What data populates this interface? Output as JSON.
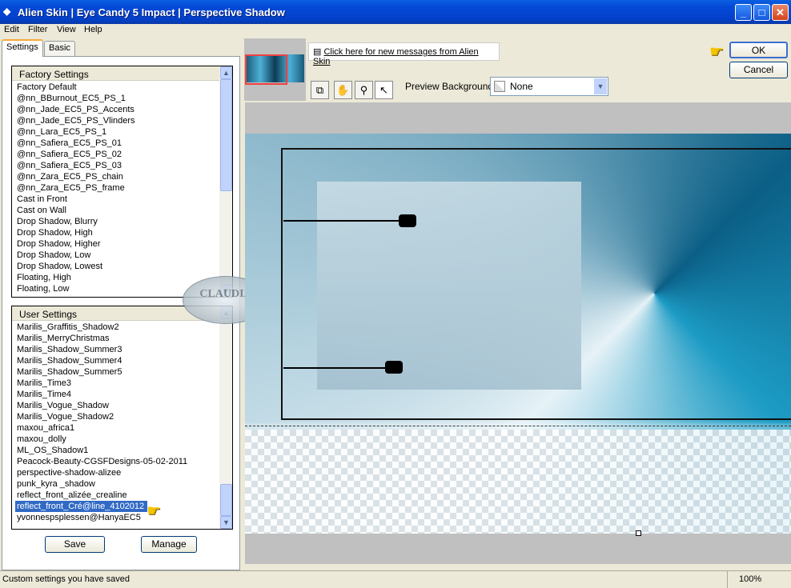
{
  "window": {
    "title": "Alien Skin | Eye Candy 5 Impact | Perspective Shadow"
  },
  "menu": [
    "Edit",
    "Filter",
    "View",
    "Help"
  ],
  "tabs": [
    "Settings",
    "Basic"
  ],
  "factory": {
    "header": "Factory Settings",
    "items": [
      "Factory Default",
      "@nn_BBurnout_EC5_PS_1",
      "@nn_Jade_EC5_PS_Accents",
      "@nn_Jade_EC5_PS_Vlinders",
      "@nn_Lara_EC5_PS_1",
      "@nn_Safiera_EC5_PS_01",
      "@nn_Safiera_EC5_PS_02",
      "@nn_Safiera_EC5_PS_03",
      "@nn_Zara_EC5_PS_chain",
      "@nn_Zara_EC5_PS_frame",
      "Cast in Front",
      "Cast on Wall",
      "Drop Shadow, Blurry",
      "Drop Shadow, High",
      "Drop Shadow, Higher",
      "Drop Shadow, Low",
      "Drop Shadow, Lowest",
      "Floating, High",
      "Floating, Low"
    ]
  },
  "user": {
    "header": "User Settings",
    "items": [
      "Marilis_Graffitis_Shadow2",
      "Marilis_MerryChristmas",
      "Marilis_Shadow_Summer3",
      "Marilis_Shadow_Summer4",
      "Marilis_Shadow_Summer5",
      "Marilis_Time3",
      "Marilis_Time4",
      "Marilis_Vogue_Shadow",
      "Marilis_Vogue_Shadow2",
      "maxou_africa1",
      "maxou_dolly",
      "ML_OS_Shadow1",
      "Peacock-Beauty-CGSFDesigns-05-02-2011",
      "perspective-shadow-alizee",
      "punk_kyra _shadow",
      "reflect_front_alizée_crealine",
      "reflect_front_Cré@line_4102012",
      "yvonnespsplessen@HanyaEC5"
    ],
    "selected": "reflect_front_Cré@line_4102012"
  },
  "buttons": {
    "save": "Save",
    "manage": "Manage",
    "ok": "OK",
    "cancel": "Cancel"
  },
  "message": "Click here for new messages from Alien Skin",
  "preview_bg": {
    "label": "Preview Background:",
    "value": "None"
  },
  "watermark": "CLAUDIA",
  "status": {
    "text": "Custom settings you have saved",
    "zoom": "100%"
  }
}
